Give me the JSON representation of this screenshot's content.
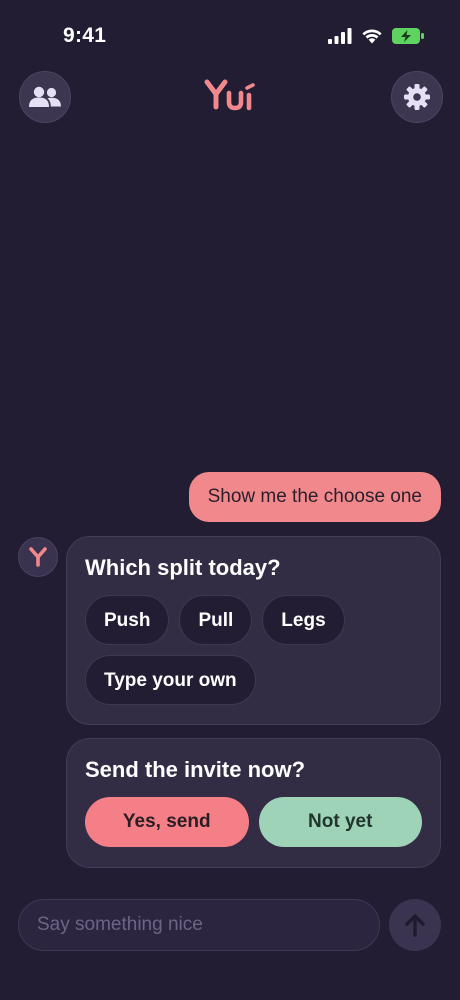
{
  "status_bar": {
    "time": "9:41"
  },
  "header": {
    "left_icon": "people-icon",
    "logo_text": "Yui",
    "right_icon": "gear-icon"
  },
  "messages": {
    "user_message": "Show me the choose one",
    "split_card": {
      "title": "Which split today?",
      "options": [
        "Push",
        "Pull",
        "Legs",
        "Type your own"
      ]
    },
    "invite_card": {
      "title": "Send the invite now?",
      "confirm_label": "Yes, send",
      "decline_label": "Not yet"
    }
  },
  "composer": {
    "placeholder": "Say something nice",
    "value": "",
    "send_icon": "arrow-up-icon"
  },
  "colors": {
    "background": "#221d33",
    "accent_pink": "#f47f86",
    "accent_green": "#9fd3b7",
    "battery_green": "#5fd35f"
  }
}
